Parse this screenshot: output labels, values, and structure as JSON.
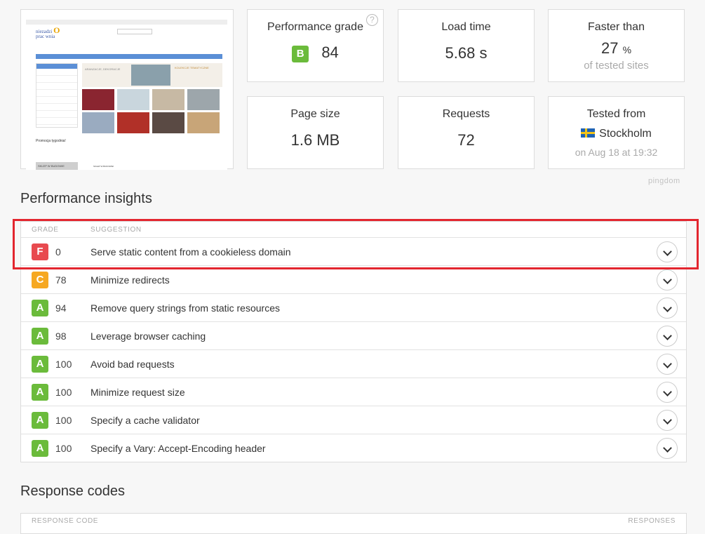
{
  "thumbnail": {
    "logo_line1": "niezadzi",
    "logo_line2": "prac",
    "logo_line3": "wnia",
    "banner_text": "ARANZACJE, DEKORACJE",
    "banner_text2": "KOLEKCJE TEMATYCZNE",
    "promo_label": "Promocja tygodnia!",
    "bottom_label": "SKLEP W BUDOWIE",
    "bottom_label2": "SKLEP W BUDOWIE!"
  },
  "stats": {
    "grade": {
      "label": "Performance grade",
      "letter": "B",
      "value": "84",
      "color": "#6bbb3b"
    },
    "load_time": {
      "label": "Load time",
      "value": "5.68 s"
    },
    "faster_than": {
      "label": "Faster than",
      "value": "27",
      "unit": "%",
      "sub": "of tested sites"
    },
    "page_size": {
      "label": "Page size",
      "value": "1.6 MB"
    },
    "requests": {
      "label": "Requests",
      "value": "72"
    },
    "tested_from": {
      "label": "Tested from",
      "location": "Stockholm",
      "sub": "on Aug 18 at 19:32"
    }
  },
  "brand": "pingdom",
  "insights": {
    "title": "Performance insights",
    "col_grade": "GRADE",
    "col_suggestion": "SUGGESTION",
    "rows": [
      {
        "letter": "F",
        "score": "0",
        "suggestion": "Serve static content from a cookieless domain",
        "color": "#e84a4f"
      },
      {
        "letter": "C",
        "score": "78",
        "suggestion": "Minimize redirects",
        "color": "#f6a821"
      },
      {
        "letter": "A",
        "score": "94",
        "suggestion": "Remove query strings from static resources",
        "color": "#6bbb3b"
      },
      {
        "letter": "A",
        "score": "98",
        "suggestion": "Leverage browser caching",
        "color": "#6bbb3b"
      },
      {
        "letter": "A",
        "score": "100",
        "suggestion": "Avoid bad requests",
        "color": "#6bbb3b"
      },
      {
        "letter": "A",
        "score": "100",
        "suggestion": "Minimize request size",
        "color": "#6bbb3b"
      },
      {
        "letter": "A",
        "score": "100",
        "suggestion": "Specify a cache validator",
        "color": "#6bbb3b"
      },
      {
        "letter": "A",
        "score": "100",
        "suggestion": "Specify a Vary: Accept-Encoding header",
        "color": "#6bbb3b"
      }
    ]
  },
  "response_codes": {
    "title": "Response codes",
    "col_code": "RESPONSE CODE",
    "col_responses": "RESPONSES"
  },
  "highlight_color": "#e3262f"
}
